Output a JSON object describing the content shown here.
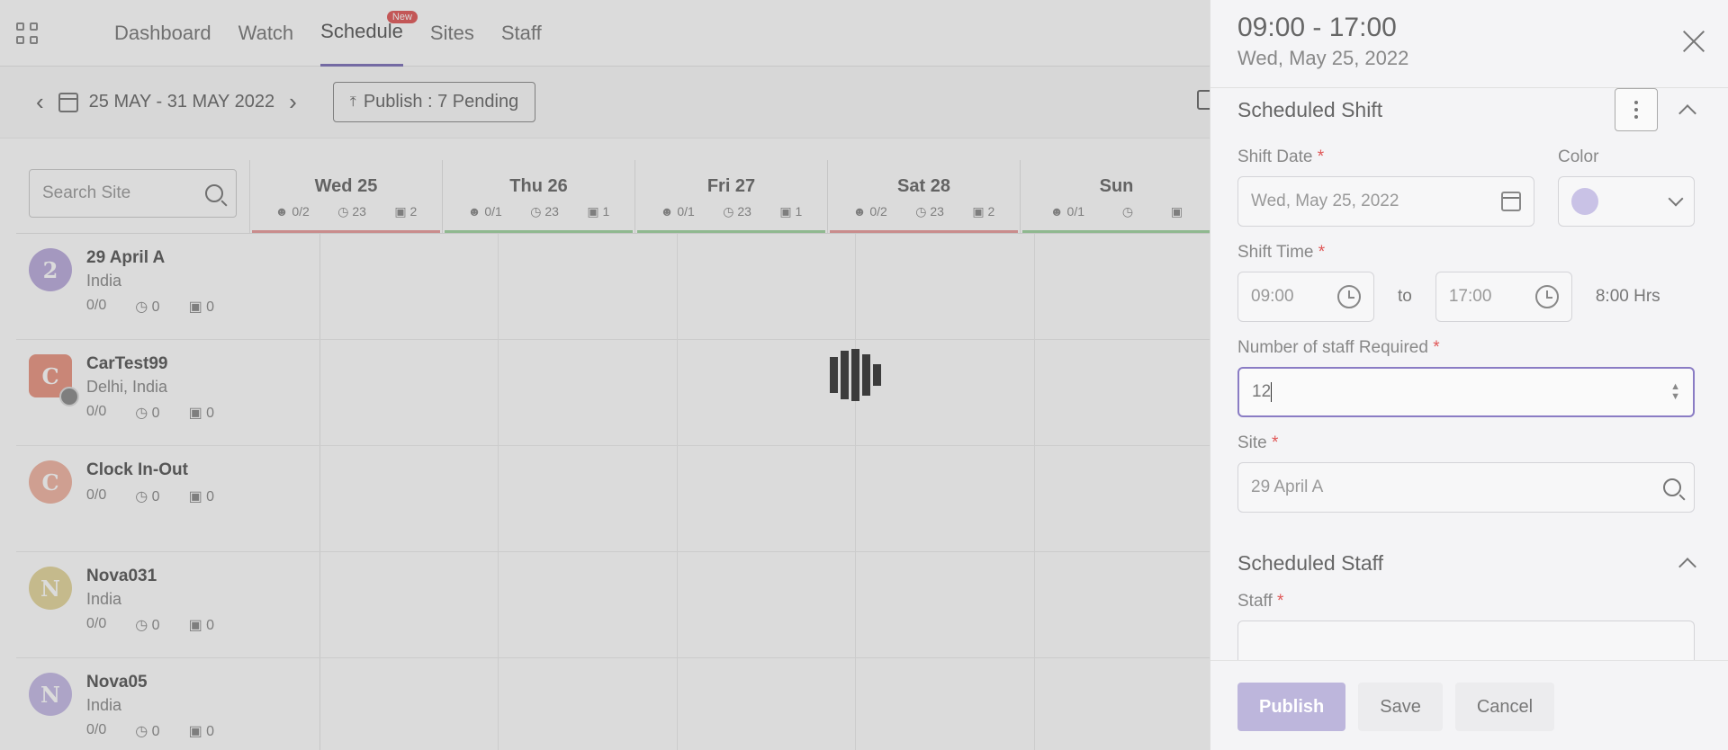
{
  "nav": {
    "items": [
      {
        "label": "Dashboard"
      },
      {
        "label": "Watch"
      },
      {
        "label": "Schedule",
        "badge": "New"
      },
      {
        "label": "Sites"
      },
      {
        "label": "Staff"
      }
    ]
  },
  "toolbar": {
    "date_range": "25 MAY - 31 MAY 2022",
    "publish_pending": "Publish : 7 Pending"
  },
  "grid": {
    "search_placeholder": "Search Site",
    "days": [
      {
        "name": "Wed 25",
        "staff": "0/2",
        "hours": "23",
        "shifts": "2",
        "bar_color": "#e89a9a"
      },
      {
        "name": "Thu 26",
        "staff": "0/1",
        "hours": "23",
        "shifts": "1",
        "bar_color": "#9ed39e"
      },
      {
        "name": "Fri 27",
        "staff": "0/1",
        "hours": "23",
        "shifts": "1",
        "bar_color": "#9ed39e"
      },
      {
        "name": "Sat 28",
        "staff": "0/2",
        "hours": "23",
        "shifts": "2",
        "bar_color": "#e89a9a"
      },
      {
        "name": "Sun",
        "staff": "0/1",
        "hours": "",
        "shifts": "",
        "bar_color": "#9ed39e"
      }
    ],
    "sites": [
      {
        "initial": "2",
        "name": "29 April A",
        "location": "India",
        "staff": "0/0",
        "hours": "0",
        "shifts": "0",
        "color": "#b9a9dc"
      },
      {
        "initial": "C",
        "name": "CarTest99",
        "location": "Delhi, India",
        "staff": "0/0",
        "hours": "0",
        "shifts": "0",
        "color": "#e8937f"
      },
      {
        "initial": "C",
        "name": "Clock In-Out",
        "location": "",
        "staff": "0/0",
        "hours": "0",
        "shifts": "0",
        "color": "#f0b3a0"
      },
      {
        "initial": "N",
        "name": "Nova031",
        "location": "India",
        "staff": "0/0",
        "hours": "0",
        "shifts": "0",
        "color": "#e3d59a"
      },
      {
        "initial": "N",
        "name": "Nova05",
        "location": "India",
        "staff": "0/0",
        "hours": "0",
        "shifts": "0",
        "color": "#c4b9e6"
      }
    ]
  },
  "drawer": {
    "time": "09:00 - 17:00",
    "date": "Wed, May 25, 2022",
    "scheduled_shift_title": "Scheduled Shift",
    "shift_date_label": "Shift Date",
    "shift_date_value": "Wed, May 25, 2022",
    "color_label": "Color",
    "color_value": "#c9c2e6",
    "shift_time_label": "Shift Time",
    "start_time": "09:00",
    "to_word": "to",
    "end_time": "17:00",
    "duration": "8:00 Hrs",
    "staff_required_label": "Number of staff Required",
    "staff_required_value": "12",
    "site_label": "Site",
    "site_value": "29 April A",
    "scheduled_staff_title": "Scheduled Staff",
    "staff_label": "Staff",
    "required_mark": "*"
  },
  "footer": {
    "publish": "Publish",
    "save": "Save",
    "cancel": "Cancel"
  }
}
